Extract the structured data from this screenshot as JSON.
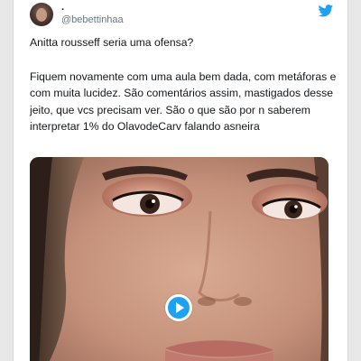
{
  "tweet": {
    "author": {
      "display_name": ".",
      "handle": "@bebettinhaa",
      "avatar_icon": "profile-photo"
    },
    "platform_icon": "twitter-bird-icon",
    "brand_color": "#1da1f2",
    "paragraphs": [
      "Anitta rousseff seria uma ofensa?",
      "Fiquem novamente com uma aula bem dada, com metáforas e com muita lucidez. São comentários assim, mastigados desse jeito, que vcs precisam ver. São o que são por n saberem interpretar 1% do OlavodeCarv falando asneira"
    ],
    "media": {
      "type": "video",
      "play_icon": "play-icon"
    }
  }
}
